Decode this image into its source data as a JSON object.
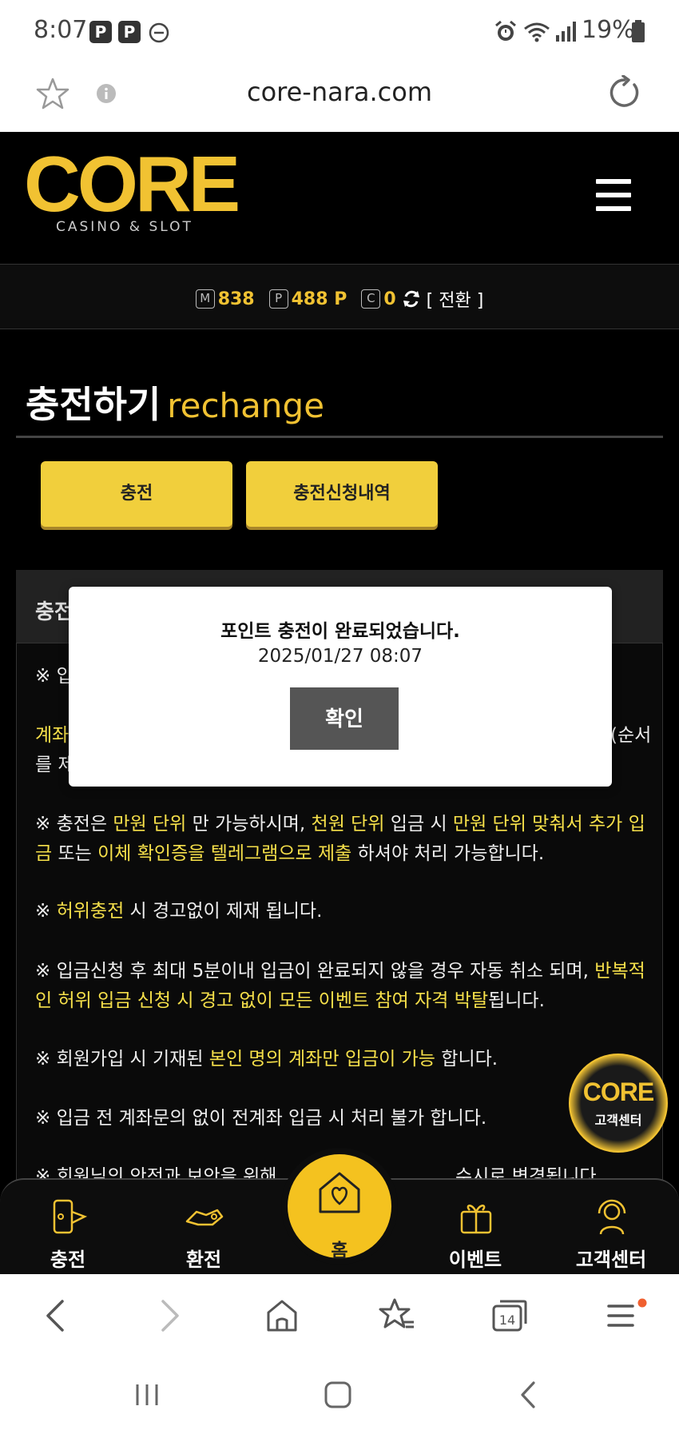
{
  "status_bar": {
    "time": "8:07",
    "badge1": "P",
    "badge2": "P",
    "battery": "19%"
  },
  "browser": {
    "url": "core-nara.com"
  },
  "site": {
    "logo": "CORE",
    "logo_sub": "CASINO & SLOT"
  },
  "balance": {
    "money_icon": "M",
    "money": "838",
    "point_icon": "P",
    "point": "488 P",
    "comp_icon": "C",
    "comp": "0",
    "switch_label": "[ 전환 ]"
  },
  "page": {
    "title_ko": "충전하기",
    "title_en": "rechange"
  },
  "tabs": [
    {
      "label": "충전"
    },
    {
      "label": "충전신청내역"
    }
  ],
  "panel": {
    "header": "충전"
  },
  "notices": {
    "n1_prefix": "※ 입",
    "n2_start": "계좌",
    "n2_end": "(순서",
    "n2_line2": "를 제",
    "n3_a": "※ 충전은 ",
    "n3_b": "만원 단위",
    "n3_c": " 만 가능하시며, ",
    "n3_d": "천원 단위",
    "n3_e": " 입금 시 ",
    "n3_f": "만원 단위 맞춰서 추가 입금",
    "n3_g": " 또는 ",
    "n3_h": "이체 확인증을 텔레그램으로 제출",
    "n3_i": " 하셔야 처리 가능합니다.",
    "n4_a": "※ ",
    "n4_b": "허위충전",
    "n4_c": " 시 경고없이 제재 됩니다.",
    "n5_a": "※ 입금신청 후 최대 5분이내 입금이 완료되지 않을 경우 자동 취소 되며, ",
    "n5_b": "반복적인 허위 입금 신청 시 경고 없이 모든 이벤트 참여 자격 박탈",
    "n5_c": "됩니다.",
    "n6_a": "※ 회원가입 시 기재된 ",
    "n6_b": "본인 명의 계좌만 입금이 가능",
    "n6_c": " 합니다.",
    "n7": "※ 입금 전 계좌문의 없이 전계좌 입금 시 처리 불가 합니다.",
    "n8_a": "※ 회원님의 안전과 보안을 위해",
    "n8_b": "수시로 변경됩니다"
  },
  "modal": {
    "message": "포인트 충전이 완료되었습니다.",
    "datetime": "2025/01/27 08:07",
    "confirm_label": "확인"
  },
  "cs_float": {
    "logo": "CORE",
    "label": "고객센터"
  },
  "bottom_nav": {
    "charge": "충전",
    "exchange": "환전",
    "home": "홈",
    "event": "이벤트",
    "support": "고객센터"
  },
  "browser_nav": {
    "tabs_count": "14"
  },
  "colors": {
    "accent": "#f1c232",
    "highlight_text": "#f6e04a",
    "background": "#000000"
  }
}
